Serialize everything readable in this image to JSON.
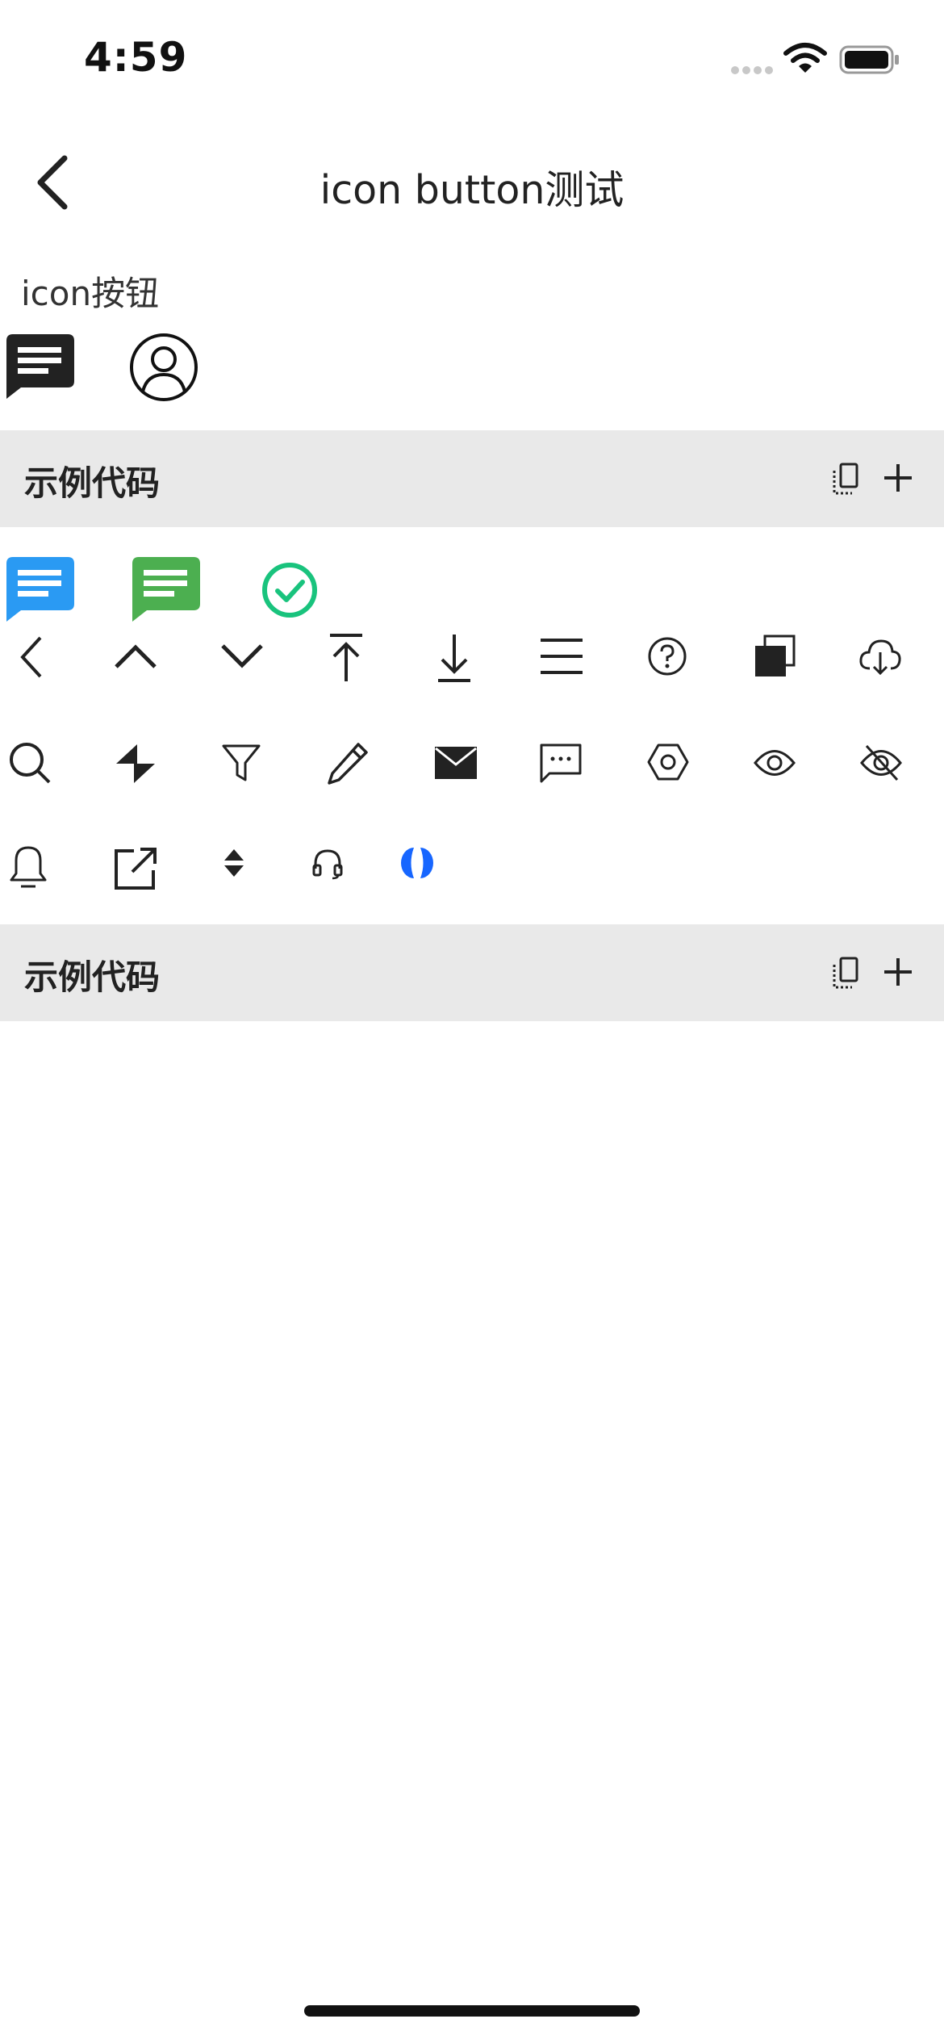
{
  "status_bar": {
    "time": "4:59",
    "icons": [
      "signal-icon",
      "wifi-icon",
      "battery-icon"
    ]
  },
  "nav": {
    "title": "icon button测试",
    "back_icon": "back-arrow-icon"
  },
  "section": {
    "label": "icon按钮"
  },
  "code_bars": [
    {
      "title": "示例代码",
      "actions": [
        "copy-icon",
        "plus-icon"
      ]
    },
    {
      "title": "示例代码",
      "actions": [
        "copy-icon",
        "plus-icon"
      ]
    }
  ],
  "colors": {
    "blue": "#2a9af3",
    "green": "#4caf50",
    "check_green": "#19c37d",
    "accent_blue": "#1766ff",
    "bar_bg": "#e9e9e9"
  },
  "icon_rows": {
    "row1": [
      "message-icon",
      "user-circle-icon"
    ],
    "row2": [
      "message-blue-icon",
      "message-green-icon",
      "check-circle-icon"
    ],
    "row3": [
      "chevron-left-icon",
      "chevron-up-icon",
      "chevron-down-icon",
      "upload-icon",
      "download-icon",
      "menu-icon",
      "help-circle-icon",
      "copy-filled-icon",
      "cloud-download-icon"
    ],
    "row4": [
      "search-icon",
      "bolt-icon",
      "filter-icon",
      "edit-icon",
      "mail-icon",
      "comment-icon",
      "settings-hexagon-icon",
      "eye-icon",
      "eye-off-icon"
    ],
    "row5": [
      "bell-icon",
      "external-link-icon",
      "sort-icon",
      "headset-icon",
      "loading-icon"
    ]
  }
}
